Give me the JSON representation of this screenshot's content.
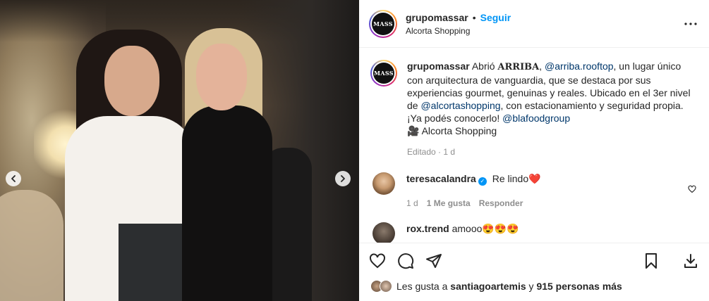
{
  "header": {
    "avatar_text": "MASS",
    "username": "grupomassar",
    "separator": "•",
    "follow_label": "Seguir",
    "location": "Alcorta Shopping",
    "more_icon": "more-horizontal-icon"
  },
  "caption": {
    "username": "grupomassar",
    "text_1": "Abrió",
    "brand": "ARRIBA",
    "text_2": ",",
    "mention_1": "@arriba.rooftop",
    "text_3": ", un lugar único con arquitectura de vanguardia, que se destaca por sus experiencias gourmet, genuinas y reales. Ubicado en el 3er nivel de",
    "mention_2": "@alcortashopping",
    "text_4": ", con estacionamiento y seguridad propia. ¡Ya podés conocerlo!",
    "mention_3": "@blafoodgroup",
    "camera_emoji": "🎥",
    "location_line": "Alcorta Shopping",
    "meta": "Editado · 1 d"
  },
  "comments": [
    {
      "username": "teresacalandra",
      "verified_mark": "✓",
      "text": "Re lindo❤️",
      "time": "1 d",
      "likes": "1 Me gusta",
      "reply": "Responder"
    },
    {
      "username": "rox.trend",
      "text": "amooo😍😍😍"
    }
  ],
  "likes": {
    "prefix": "Les gusta a",
    "user": "santiagoartemis",
    "joiner": "y",
    "others": "915 personas más"
  },
  "colors": {
    "link_blue": "#0095f6",
    "mention": "#00376b",
    "muted": "#8e8e8e"
  }
}
